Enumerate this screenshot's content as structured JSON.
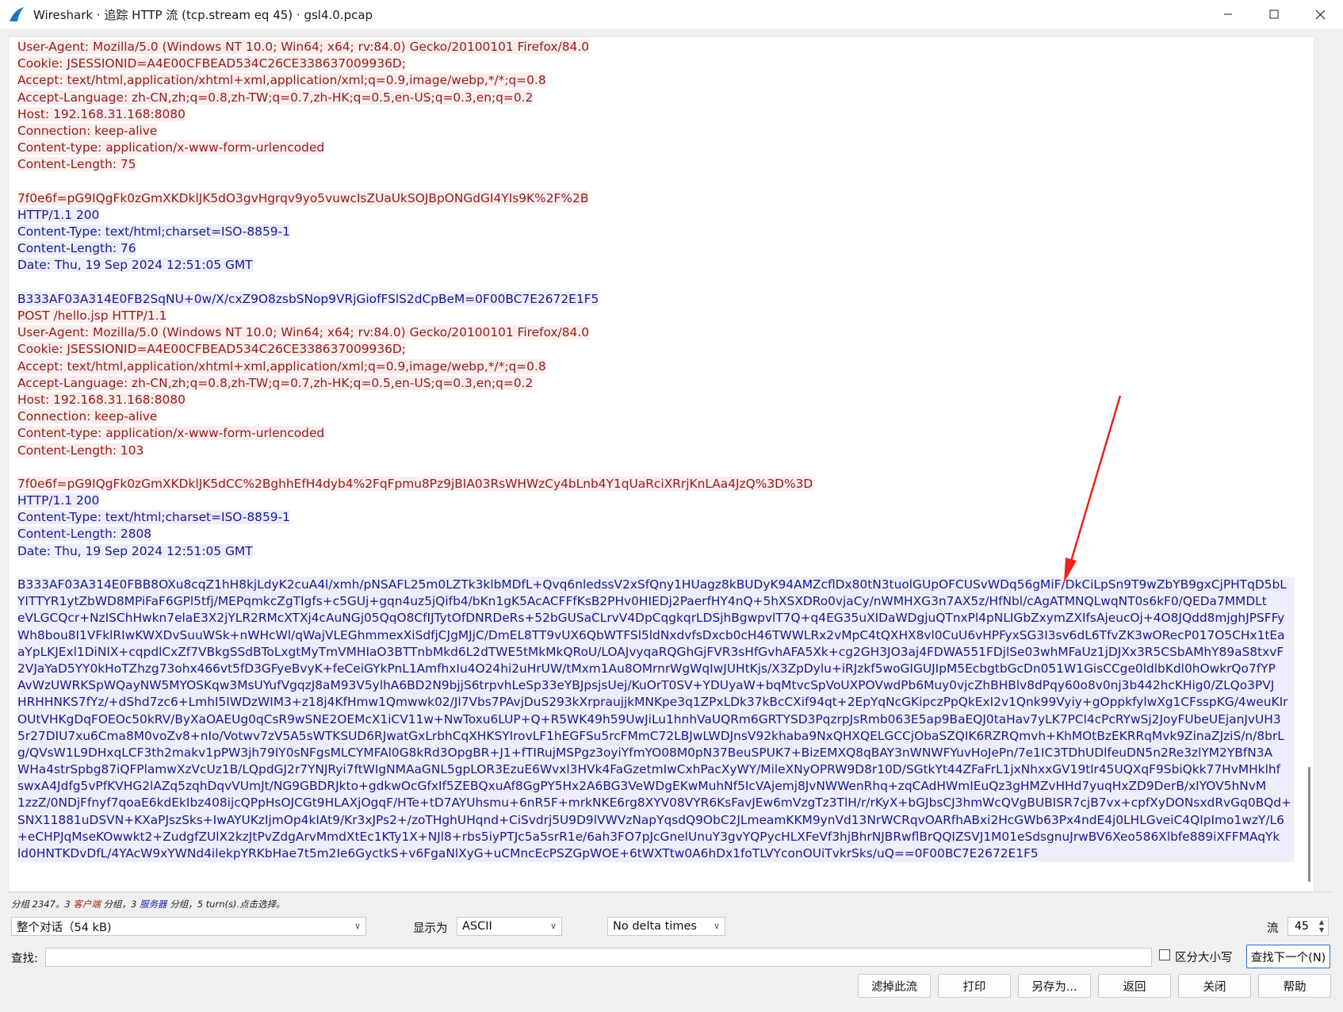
{
  "window": {
    "title": "Wireshark · 追踪 HTTP 流 (tcp.stream eq 45) · gsl4.0.pcap",
    "controls": [
      "minimize-icon",
      "maximize-icon",
      "close-icon"
    ]
  },
  "stream_lines": [
    {
      "text": "User-Agent: Mozilla/5.0 (Windows NT 10.0; Win64; x64; rv:84.0) Gecko/20100101 Firefox/84.0",
      "dir": "client"
    },
    {
      "text": "Cookie: JSESSIONID=A4E00CFBEAD534C26CE338637009936D;",
      "dir": "client"
    },
    {
      "text": "Accept: text/html,application/xhtml+xml,application/xml;q=0.9,image/webp,*/*;q=0.8",
      "dir": "client"
    },
    {
      "text": "Accept-Language: zh-CN,zh;q=0.8,zh-TW;q=0.7,zh-HK;q=0.5,en-US;q=0.3,en;q=0.2",
      "dir": "client"
    },
    {
      "text": "Host: 192.168.31.168:8080",
      "dir": "client"
    },
    {
      "text": "Connection: keep-alive",
      "dir": "client"
    },
    {
      "text": "Content-type: application/x-www-form-urlencoded",
      "dir": "client"
    },
    {
      "text": "Content-Length: 75",
      "dir": "client"
    },
    {
      "text": "",
      "dir": "client"
    },
    {
      "text": "7f0e6f=pG9IQgFk0zGmXKDklJK5dO3gvHgrqv9yo5vuwcIsZUaUkSOJBpONGdGI4YIs9K%2F%2B",
      "dir": "client"
    },
    {
      "text": "HTTP/1.1 200",
      "dir": "server"
    },
    {
      "text": "Content-Type: text/html;charset=ISO-8859-1",
      "dir": "server"
    },
    {
      "text": "Content-Length: 76",
      "dir": "server"
    },
    {
      "text": "Date: Thu, 19 Sep 2024 12:51:05 GMT",
      "dir": "server"
    },
    {
      "text": "",
      "dir": "server"
    },
    {
      "text": "B333AF03A314E0FB2SqNU+0w/X/cxZ9O8zsbSNop9VRjGiofFSlS2dCpBeM=0F00BC7E2672E1F5",
      "dir": "server"
    },
    {
      "text": "POST /hello.jsp HTTP/1.1",
      "dir": "client"
    },
    {
      "text": "User-Agent: Mozilla/5.0 (Windows NT 10.0; Win64; x64; rv:84.0) Gecko/20100101 Firefox/84.0",
      "dir": "client"
    },
    {
      "text": "Cookie: JSESSIONID=A4E00CFBEAD534C26CE338637009936D;",
      "dir": "client"
    },
    {
      "text": "Accept: text/html,application/xhtml+xml,application/xml;q=0.9,image/webp,*/*;q=0.8",
      "dir": "client"
    },
    {
      "text": "Accept-Language: zh-CN,zh;q=0.8,zh-TW;q=0.7,zh-HK;q=0.5,en-US;q=0.3,en;q=0.2",
      "dir": "client"
    },
    {
      "text": "Host: 192.168.31.168:8080",
      "dir": "client"
    },
    {
      "text": "Connection: keep-alive",
      "dir": "client"
    },
    {
      "text": "Content-type: application/x-www-form-urlencoded",
      "dir": "client"
    },
    {
      "text": "Content-Length: 103",
      "dir": "client"
    },
    {
      "text": "",
      "dir": "client"
    },
    {
      "text": "7f0e6f=pG9IQgFk0zGmXKDklJK5dCC%2BghhEfH4dyb4%2FqFpmu8Pz9jBIA03RsWHWzCy4bLnb4Y1qUaRciXRrjKnLAa4JzQ%3D%3D",
      "dir": "client"
    },
    {
      "text": "HTTP/1.1 200",
      "dir": "server"
    },
    {
      "text": "Content-Type: text/html;charset=ISO-8859-1",
      "dir": "server"
    },
    {
      "text": "Content-Length: 2808",
      "dir": "server"
    },
    {
      "text": "Date: Thu, 19 Sep 2024 12:51:05 GMT",
      "dir": "server"
    },
    {
      "text": "",
      "dir": "server"
    }
  ],
  "payload_lines": [
    "B333AF03A314E0FBB8OXu8cqZ1hH8kjLdyK2cuA4l/xmh/pNSAFL25m0LZTk3klbMDfL+Qvq6nledssV2xSfQny1HUagz8kBUDyK94AMZcflDx80tN3tuolGUpOFCUSvWDq56gMiF/DkCiLpSn9T9wZbYB9gxCjPHTqD5bL",
    "YITTYR1ytZbWD8MPiFaF6GPl5tfj/MEPqmkcZgTIgfs+c5GUj+gqn4uz5jQifb4/bKn1gK5AcACFFfKsB2PHv0HIEDj2PaerfHY4nQ+5hXSXDRo0vjaCy/nWMHXG3n7AX5z/HfNbl/cAgATMNQLwqNT0s6kF0/QEDa7MMDLt",
    "eVLGCQcr+NzISChHwkn7elaE3X2jYLR2RMcXTXj4cAuNGj05QqO8CfIJTytOfDNRDeRs+52bGUSaCLrvV4DpCqgkqrLDSjhBgwpvlT7Q+q4EG35uXIDaWDgjuQTnxPl4pNLIGbZxymZXIfsAjeucOj+4O8JQdd8mjghJPSFFy",
    "Wh8bou8I1VFklRIwKWXDvSuuWSk+nWHcWl/qWajVLEGhmmexXiSdfjCJgMJjC/DmEL8TT9vUX6QbWTFSl5ldNxdvfsDxcb0cH46TWWLRx2vMpC4tQXHX8vl0CuU6vHPFyxSG3I3sv6dL6TfvZK3wORecP017O5CHx1tEa",
    "aYpLKJExl1DiNIX+cqpdlCxZf7VBkgSSdBToLxgtMyTmVMHIaO3BTTnbMkd6L2dTWE5tMkMkQRoU/LOAJvyqaRQGhGjFVR3sHfGvhAFA5Xk+cg2GH3JO3aj4FDWA551FDjlSe03whMFaUz1jDJXx3R5CSbAMhY89aS8txvF",
    "2VJaYaD5YY0kHoTZhzg73ohx466vt5fD3GFyeBvyK+feCeiGYkPnL1AmfhxIu4O24hi2uHrUW/tMxm1Au8OMrnrWgWqIwJUHtKjs/X3ZpDylu+iRJzkf5woGIGUJIpM5EcbgtbGcDn051W1GisCCge0ldlbKdl0hOwkrQo7fYP",
    "AvWzUWRKSpWQayNW5MYOSKqw3MsUYufVgqzJ8aM93V5ylhA6BD2N9bjjS6trpvhLeSp33eYBJpsjsUej/KuOrT0SV+YDUyaW+bqMtvcSpVoUXPOVwdPb6Muy0vjcZhBHBlv8dPqy60o8v0nj3b442hcKHig0/ZLQo3PVJ",
    "HRHHNKS7fYz/+dShd7zc6+LmhI5IWDzWIM3+z18j4KfHmw1Qmwwk02/Jl7Vbs7PAvjDuS293kXrpraujjkMNKpe3q1ZPxLDk37kBcCXif94qt+2EpYqNcGKipczPpQkExI2v1Qnk99Vyiy+gOppkfylwXg1CFsspKG/4weuKIr",
    "OUtVHKgDqFOEOc50kRV/ByXaOAEUg0qCsR9wSNE2OEMcX1iCV11w+NwToxu6LUP+Q+R5WK49h59UwJiLu1hnhVaUQRm6GRTYSD3PqzrpJsRmb063E5ap9BaEQJ0taHav7yLK7PCl4cPcRYwSj2JoyFUbeUEjanJvUH3",
    "5r27DIU7xu6Cma8M0voZv8+nIo/Votwv7zV5A5sWTKSUD6RJwatGxLrbhCqXHKSYIrovLF1hEGFSu5rcFMmC72LBJwLWDJnsV92khaba9NxQHXQELGCCjObaSZQIK6RZRQmvh+KhMOtBzEKRRqMvk9ZinaZJziS/n/8brL",
    "g/QVsW1L9DHxqLCF3th2makv1pPW3jh79IY0sNFgsMLCYMFAl0G8kRd3OpgBR+J1+fTIRujMSPgz3oyiYfmYO08M0pN37BeuSPUK7+BizEMXQ8qBAY3nWNWFYuvHoJePn/7e1IC3TDhUDlfeuDN5n2Re3zlYM2YBfN3A",
    "WHa4strSpbg87iQFPlamwXzVcUz1B/LQpdGJ2r7YNJRyi7ftWIgNMAaGNL5gpLOR3EzuE6Wvxl3HVk4FaGzetmIwCxhPacXyWY/MileXNyOPRW9D8r10D/SGtkYt44ZFaFrL1jxNhxxGV19tlr45UQXqF9SbiQkk77HvMHklhf",
    "swxA4Jdfg5vPfKVHG2lAZq5zqhDqvVUmJt/NG9GBDRJkto+gdkwOcGfxIf5ZEBQxuAf8GgPY5Hx2A6BG3VeWDgEKwMuhNf5IcVAjemj8JvNWWenRhq+zqCAdHWmIEuQz3gHMZvHHd7yuqHxZD9DerB/xIYOV5hNvM",
    "1zzZ/0NDjFfnyf7qoaE6kdEkIbz408ijcQPpHsOJCGt9HLAXjOgqF/HTe+tD7AYUhsmu+6nR5F+mrkNKE6rg8XYV08VYR6KsFavJEw6mVzgTz3TlH/r/rKyX+bGJbsCJ3hmWcQVgBUBISR7cjB7vx+cpfXyDONsxdRvGq0BQd+",
    "SNX11881uDSVN+KXaPJszSks+IwAYUKzIjmOp4kIAt9/Kr3xJPs2+/zoTHghUHqnd+CiSvdrj5U9D9lVWVzNapYqsdQ9ObC2JLmeamKKM9ynVd13NrWCRqvOARfhABxi2HcGWb63Px4ndE4j0LHLGveiC4QIpImo1wzY/L6",
    "+eCHPJqMseKOwwkt2+ZudgfZUlX2kzJtPvZdgArvMmdXtEc1KTy1X+NJl8+rbs5iyPTJc5a5srR1e/6ah3FO7pJcGnelUnuY3gvYQPycHLXFeVf3hjBhrNJBRwflBrQQIZSVJ1M01eSdsgnuJrwBV6Xeo586Xlbfe889iXFFMAqYk",
    "ld0HNTKDvDfL/4YAcW9xYWNd4ilekpYRKbHae7t5m2Ie6GyctkS+v6FgaNlXyG+uCMncEcPSZGpWOE+6tWXTtw0A6hDx1foTLVYconOUiTvkrSks/uQ==0F00BC7E2672E1F5"
  ],
  "status": {
    "prefix": "分组 2347。3 ",
    "client_word": "客户端",
    "mid1": " 分组，3 ",
    "server_word": "服务器",
    "suffix": " 分组，5 turn(s).点击选择。"
  },
  "controls": {
    "conversation_select": "整个对话（54 kB)",
    "show_as_label": "显示为",
    "show_as_value": "ASCII",
    "delta_select": "No delta times",
    "stream_label": "流",
    "stream_value": "45",
    "find_label": "查找:",
    "find_value": "",
    "case_label": "区分大小写",
    "find_next": "查找下一个(N)"
  },
  "buttons": {
    "filter_out": "滤掉此流",
    "print": "打印",
    "save_as": "另存为...",
    "back": "返回",
    "close": "关闭",
    "help": "帮助"
  },
  "colors": {
    "client_text": "#8f1d1d",
    "client_bg": "#fbeded",
    "server_text": "#1a1a8c",
    "server_bg": "#ededfb",
    "annotation_arrow": "#e8231b"
  }
}
